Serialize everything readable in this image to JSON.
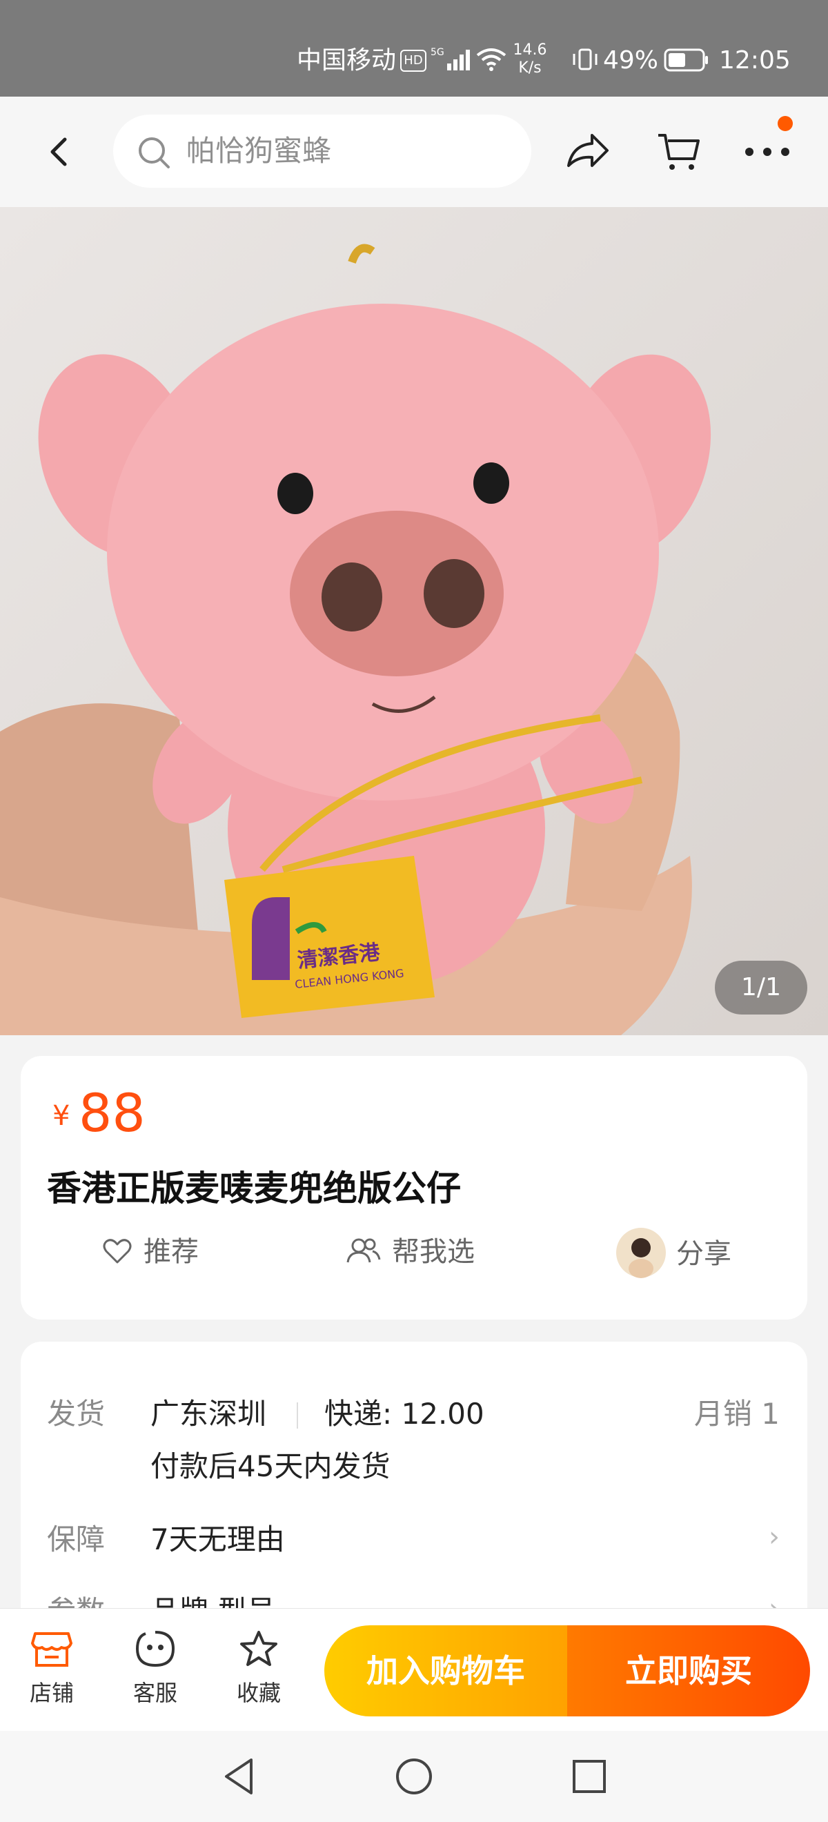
{
  "status_bar": {
    "carrier": "中国移动",
    "net_speed_value": "14.6",
    "net_speed_unit": "K/s",
    "battery": "49%",
    "time": "12:05"
  },
  "top_nav": {
    "search_placeholder": "帕恰狗蜜蜂"
  },
  "gallery": {
    "counter": "1/1",
    "bag_text": "清潔香港",
    "bag_subtext": "CLEAN HONG KONG"
  },
  "product": {
    "currency": "¥",
    "price": "88",
    "title": "香港正版麦唛麦兜绝版公仔",
    "actions": [
      {
        "label": "推荐",
        "icon": "heart-icon"
      },
      {
        "label": "帮我选",
        "icon": "people-icon"
      },
      {
        "label": "分享",
        "icon": "avatar-icon"
      }
    ]
  },
  "details": {
    "shipping_label": "发货",
    "origin": "广东深圳",
    "express": "快递: 12.00",
    "monthly_sales": "月销 1",
    "ship_time": "付款后45天内发货",
    "guarantee_label": "保障",
    "guarantee_value": "7天无理由",
    "params_label": "参数",
    "params_value": "品牌 型号"
  },
  "bottom_bar": {
    "shop": "店铺",
    "service": "客服",
    "favorite": "收藏",
    "add_to_cart": "加入购物车",
    "buy_now": "立即购买"
  },
  "colors": {
    "accent": "#ff4f0f",
    "cart_button": "#ffb400",
    "buy_button": "#ff5a00",
    "badge": "#ff5a00"
  }
}
